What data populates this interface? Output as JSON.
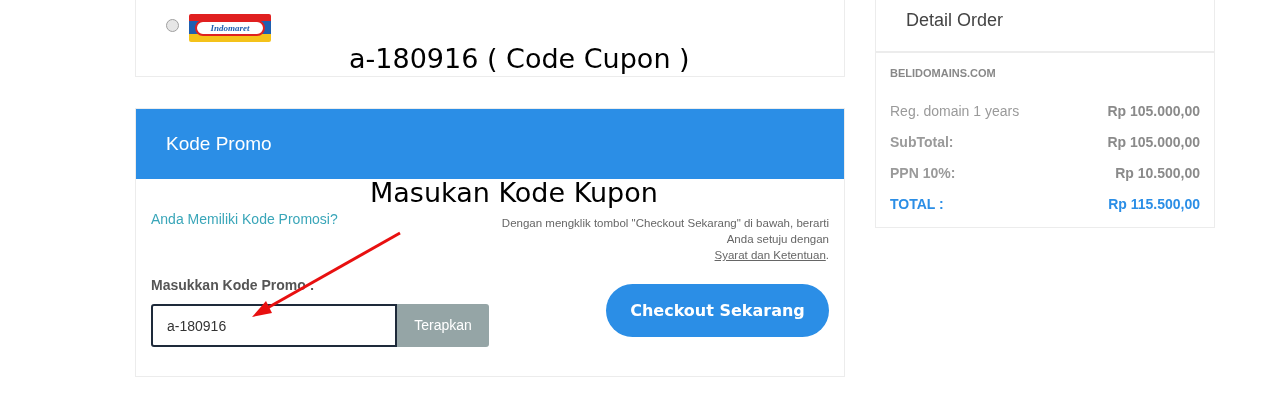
{
  "payment_option": {
    "selected": false,
    "logo_text": "Indomaret"
  },
  "annotations": {
    "coupon_note": "a-180916 ( Code Cupon )",
    "input_note": "Masukan Kode Kupon"
  },
  "promo": {
    "title": "Kode Promo",
    "question": "Anda Memiliki Kode Promosi?",
    "terms_text": "Dengan mengklik tombol \"Checkout Sekarang\" di bawah, berarti Anda setuju dengan",
    "terms_link": "Syarat dan Ketentuan",
    "terms_end": ".",
    "field_label": "Masukkan Kode Promo :",
    "field_value": "a-180916",
    "apply_button": "Terapkan",
    "checkout_button": "Checkout Sekarang"
  },
  "order": {
    "title": "Detail Order",
    "vendor": "BELIDOMAINS.COM",
    "rows": [
      {
        "kind": "line",
        "label": "Reg. domain 1 years",
        "value": "Rp 105.000,00"
      },
      {
        "kind": "subtotal",
        "label": "SubTotal:",
        "value": "Rp 105.000,00"
      },
      {
        "kind": "subtotal",
        "label": "PPN 10%:",
        "value": "Rp 10.500,00"
      },
      {
        "kind": "total",
        "label": "TOTAL :",
        "value": "Rp 115.500,00"
      }
    ]
  }
}
